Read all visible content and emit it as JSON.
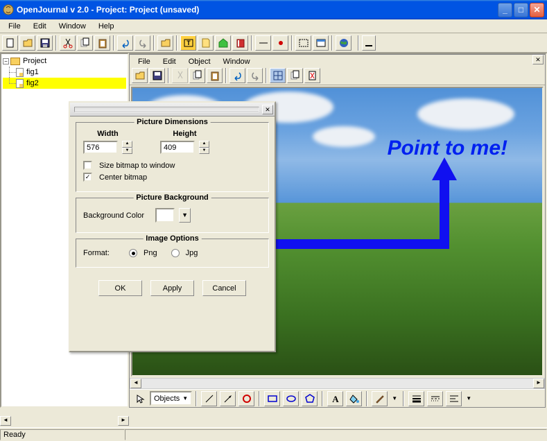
{
  "window": {
    "title": "OpenJournal v 2.0 - Project: Project (unsaved)"
  },
  "menubar": {
    "items": [
      "File",
      "Edit",
      "Window",
      "Help"
    ]
  },
  "submenubar": {
    "items": [
      "File",
      "Edit",
      "Object",
      "Window"
    ]
  },
  "tree": {
    "root": "Project",
    "children": [
      "fig1",
      "fig2"
    ],
    "selected": "fig2"
  },
  "canvas": {
    "annotation": "Point to me!"
  },
  "bottom_toolbar": {
    "objects_label": "Objects"
  },
  "dialog": {
    "groups": {
      "dimensions": {
        "title": "Picture Dimensions",
        "width_label": "Width",
        "height_label": "Height",
        "width": "576",
        "height": "409",
        "size_bitmap": "Size bitmap to window",
        "center_bitmap": "Center bitmap",
        "center_checked": true
      },
      "background": {
        "title": "Picture Background",
        "color_label": "Background Color"
      },
      "options": {
        "title": "Image Options",
        "format_label": "Format:",
        "png": "Png",
        "jpg": "Jpg",
        "selected": "Png"
      }
    },
    "buttons": {
      "ok": "OK",
      "apply": "Apply",
      "cancel": "Cancel"
    }
  },
  "status": {
    "text": "Ready"
  }
}
